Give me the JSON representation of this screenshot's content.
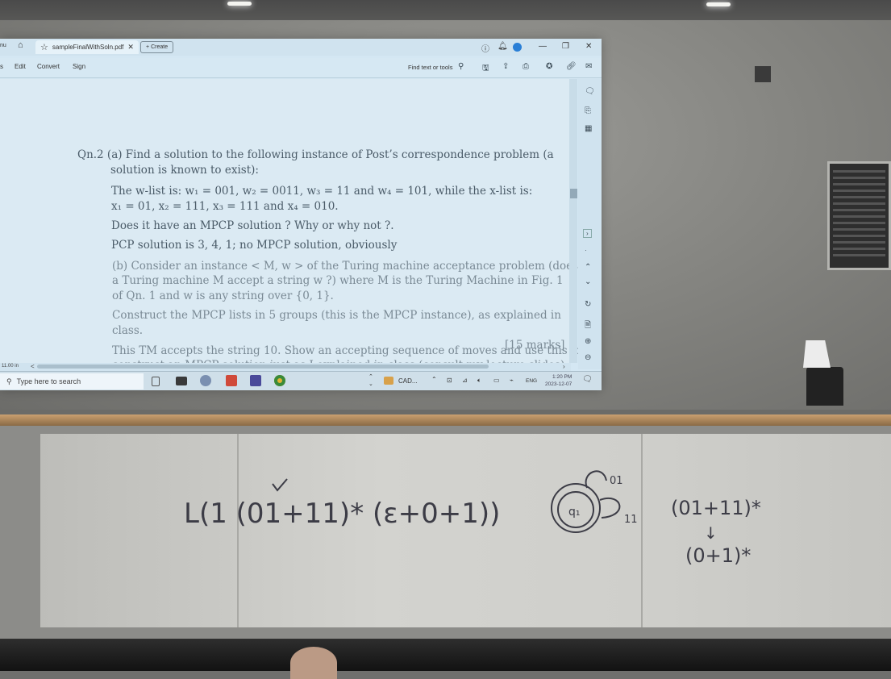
{
  "window": {
    "tab_title": "sampleFinalWithSoln.pdf",
    "tab_close": "✕",
    "create_label": "Create",
    "left_crop_label": "nu"
  },
  "menu": {
    "left_crop": "s",
    "items": [
      "Edit",
      "Convert",
      "Sign"
    ],
    "find_label": "Find text or tools"
  },
  "document": {
    "lines": [
      "Qn.2 (a) Find a solution to the following instance of Post’s correspondence problem (a",
      "solution is known to exist):",
      "The w-list is: w₁ = 001, w₂ = 0011, w₃ = 11 and w₄ = 101, while the x-list is:",
      "x₁ = 01, x₂ = 111, x₃ = 111 and x₄ = 010.",
      "Does it have an MPCP solution ? Why or why not ?.",
      "PCP solution is 3, 4, 1; no MPCP solution, obviously",
      "(b) Consider an instance < M, w > of the Turing machine acceptance problem (does",
      "a Turing machine M accept a string w ?) where M is the Turing Machine in Fig. 1",
      "of Qn. 1 and w is any string over {0, 1}.",
      "Construct the MPCP lists in 5 groups (this is the MPCP instance), as explained in",
      "class.",
      "This TM accepts the string 10. Show an accepting sequence of moves and use this to",
      "construct an MPCP solution just as I explained in class (consult my lecture slides)."
    ],
    "marks": "[15 marks]"
  },
  "status": {
    "page_size": "11.00 in",
    "collapse": "<"
  },
  "taskbar": {
    "search_placeholder": "Type here to search",
    "app_label": "CAD...",
    "lang": "ENG",
    "time": "1:20 PM",
    "date": "2023-12-07"
  },
  "whiteboard": {
    "expr1": "L(1 (01+11)* (ε+0+1))",
    "state_label": "q₁",
    "loop_top": "01",
    "loop_right": "11",
    "expr2": "(01+11)*",
    "arrow": "↓",
    "expr3": "(0+1)*"
  }
}
